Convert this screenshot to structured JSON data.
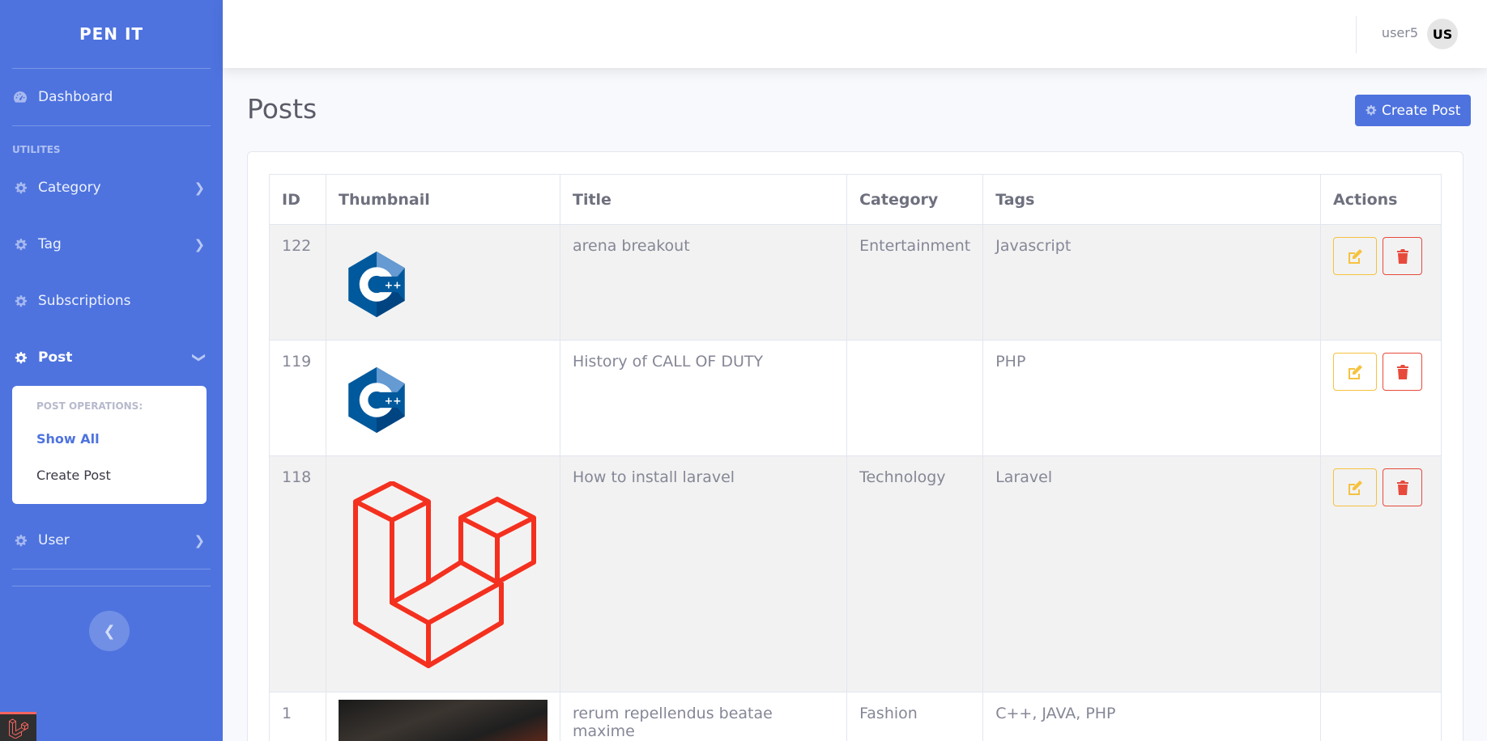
{
  "brand": "PEN IT",
  "sidebar": {
    "dashboard": "Dashboard",
    "section": "UTILITES",
    "items": [
      {
        "label": "Category"
      },
      {
        "label": "Tag"
      },
      {
        "label": "Subscriptions"
      },
      {
        "label": "Post"
      },
      {
        "label": "User"
      }
    ],
    "submenu": {
      "heading": "POST OPERATIONS:",
      "show_all": "Show All",
      "create": "Create Post"
    },
    "toggle_icon": "chevron-left-icon"
  },
  "topbar": {
    "username": "user5",
    "avatar_initials": "US"
  },
  "page": {
    "title": "Posts",
    "create_button": "Create Post"
  },
  "table": {
    "headers": [
      "ID",
      "Thumbnail",
      "Title",
      "Category",
      "Tags",
      "Actions"
    ],
    "rows": [
      {
        "id": "122",
        "thumbnail": "cpp-logo",
        "title": "arena breakout",
        "category": "Entertainment",
        "tags": "Javascript"
      },
      {
        "id": "119",
        "thumbnail": "cpp-logo",
        "title": "History of CALL OF DUTY",
        "category": "",
        "tags": "PHP"
      },
      {
        "id": "118",
        "thumbnail": "laravel-logo",
        "title": "How to install laravel",
        "category": "Technology",
        "tags": "Laravel"
      },
      {
        "id": "1",
        "thumbnail": "photo",
        "title": "rerum repellendus beatae maxime",
        "category": "Fashion",
        "tags": "C++, JAVA, PHP"
      }
    ]
  },
  "colors": {
    "primary": "#4e73df",
    "warning": "#f6c23e",
    "danger": "#e74a3b",
    "laravel": "#f4301f"
  }
}
